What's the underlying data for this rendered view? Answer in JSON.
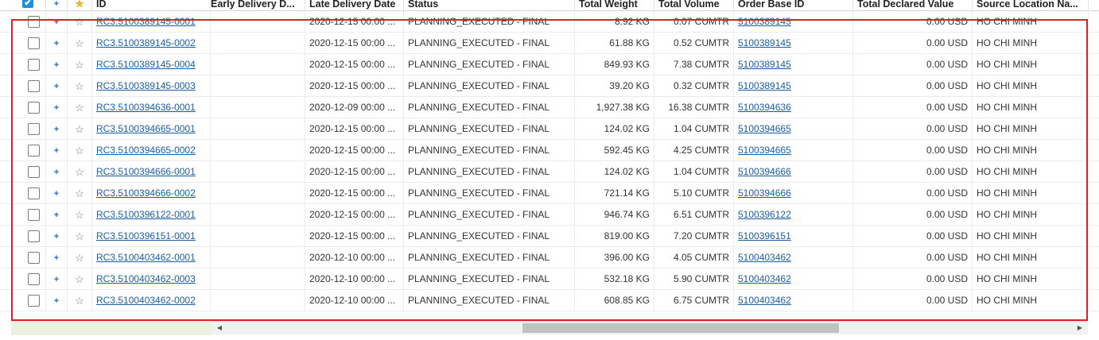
{
  "header": {
    "check_glyph": "✔",
    "plus_glyph": "+",
    "star_glyph": "★",
    "id": "ID",
    "early": "Early Delivery D...",
    "late": "Late Delivery Date",
    "status": "Status",
    "weight": "Total Weight",
    "volume": "Total Volume",
    "order": "Order Base ID",
    "declared": "Total Declared Value",
    "source": "Source Location Na..."
  },
  "row_plus": "+",
  "row_star": "☆",
  "rows": [
    {
      "id": "RC3.5100389145-0001",
      "early": "",
      "late": "2020-12-15 00:00 ...",
      "status": "PLANNING_EXECUTED - FINAL",
      "weight": "8.92 KG",
      "volume": "0.07 CUMTR",
      "order": "5100389145",
      "declared": "0.00 USD",
      "source": "HO CHI MINH"
    },
    {
      "id": "RC3.5100389145-0002",
      "early": "",
      "late": "2020-12-15 00:00 ...",
      "status": "PLANNING_EXECUTED - FINAL",
      "weight": "61.88 KG",
      "volume": "0.52 CUMTR",
      "order": "5100389145",
      "declared": "0.00 USD",
      "source": "HO CHI MINH"
    },
    {
      "id": "RC3.5100389145-0004",
      "early": "",
      "late": "2020-12-15 00:00 ...",
      "status": "PLANNING_EXECUTED - FINAL",
      "weight": "849.93 KG",
      "volume": "7.38 CUMTR",
      "order": "5100389145",
      "declared": "0.00 USD",
      "source": "HO CHI MINH"
    },
    {
      "id": "RC3.5100389145-0003",
      "early": "",
      "late": "2020-12-15 00:00 ...",
      "status": "PLANNING_EXECUTED - FINAL",
      "weight": "39.20 KG",
      "volume": "0.32 CUMTR",
      "order": "5100389145",
      "declared": "0.00 USD",
      "source": "HO CHI MINH"
    },
    {
      "id": "RC3.5100394636-0001",
      "early": "",
      "late": "2020-12-09 00:00 ...",
      "status": "PLANNING_EXECUTED - FINAL",
      "weight": "1,927.38 KG",
      "volume": "16.38 CUMTR",
      "order": "5100394636",
      "declared": "0.00 USD",
      "source": "HO CHI MINH"
    },
    {
      "id": "RC3.5100394665-0001",
      "early": "",
      "late": "2020-12-15 00:00 ...",
      "status": "PLANNING_EXECUTED - FINAL",
      "weight": "124.02 KG",
      "volume": "1.04 CUMTR",
      "order": "5100394665",
      "declared": "0.00 USD",
      "source": "HO CHI MINH"
    },
    {
      "id": "RC3.5100394665-0002",
      "early": "",
      "late": "2020-12-15 00:00 ...",
      "status": "PLANNING_EXECUTED - FINAL",
      "weight": "592.45 KG",
      "volume": "4.25 CUMTR",
      "order": "5100394665",
      "declared": "0.00 USD",
      "source": "HO CHI MINH"
    },
    {
      "id": "RC3.5100394666-0001",
      "early": "",
      "late": "2020-12-15 00:00 ...",
      "status": "PLANNING_EXECUTED - FINAL",
      "weight": "124.02 KG",
      "volume": "1.04 CUMTR",
      "order": "5100394666",
      "declared": "0.00 USD",
      "source": "HO CHI MINH"
    },
    {
      "id": "RC3.5100394666-0002",
      "early": "",
      "late": "2020-12-15 00:00 ...",
      "status": "PLANNING_EXECUTED - FINAL",
      "weight": "721.14 KG",
      "volume": "5.10 CUMTR",
      "order": "5100394666",
      "declared": "0.00 USD",
      "source": "HO CHI MINH"
    },
    {
      "id": "RC3.5100396122-0001",
      "early": "",
      "late": "2020-12-15 00:00 ...",
      "status": "PLANNING_EXECUTED - FINAL",
      "weight": "946.74 KG",
      "volume": "6.51 CUMTR",
      "order": "5100396122",
      "declared": "0.00 USD",
      "source": "HO CHI MINH"
    },
    {
      "id": "RC3.5100396151-0001",
      "early": "",
      "late": "2020-12-15 00:00 ...",
      "status": "PLANNING_EXECUTED - FINAL",
      "weight": "819.00 KG",
      "volume": "7.20 CUMTR",
      "order": "5100396151",
      "declared": "0.00 USD",
      "source": "HO CHI MINH"
    },
    {
      "id": "RC3.5100403462-0001",
      "early": "",
      "late": "2020-12-10 00:00 ...",
      "status": "PLANNING_EXECUTED - FINAL",
      "weight": "396.00 KG",
      "volume": "4.05 CUMTR",
      "order": "5100403462",
      "declared": "0.00 USD",
      "source": "HO CHI MINH"
    },
    {
      "id": "RC3.5100403462-0003",
      "early": "",
      "late": "2020-12-10 00:00 ...",
      "status": "PLANNING_EXECUTED - FINAL",
      "weight": "532.18 KG",
      "volume": "5.90 CUMTR",
      "order": "5100403462",
      "declared": "0.00 USD",
      "source": "HO CHI MINH"
    },
    {
      "id": "RC3.5100403462-0002",
      "early": "",
      "late": "2020-12-10 00:00 ...",
      "status": "PLANNING_EXECUTED - FINAL",
      "weight": "608.85 KG",
      "volume": "6.75 CUMTR",
      "order": "5100403462",
      "declared": "0.00 USD",
      "source": "HO CHI MINH"
    }
  ],
  "scrollbar": {
    "left_arrow": "◀",
    "right_arrow": "▶"
  },
  "colors": {
    "link": "#1a5ea8",
    "selection_border": "#e02020",
    "header_check": "#1e8fe0",
    "star_header": "#f0b323"
  }
}
